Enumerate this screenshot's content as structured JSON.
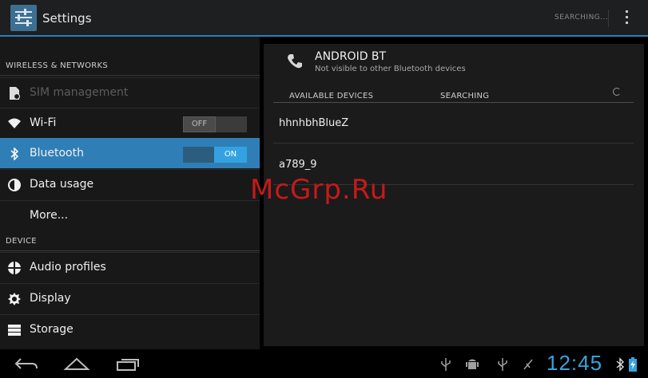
{
  "action_bar": {
    "title": "Settings",
    "status": "SEARCHING..."
  },
  "sidebar": {
    "sections": [
      {
        "header": "WIRELESS & NETWORKS"
      },
      {
        "header": "DEVICE"
      }
    ],
    "items": [
      {
        "label": "SIM management",
        "icon": "sim-icon",
        "disabled": true
      },
      {
        "label": "Wi-Fi",
        "icon": "wifi-icon",
        "toggle": "OFF"
      },
      {
        "label": "Bluetooth",
        "icon": "bluetooth-icon",
        "toggle": "ON",
        "selected": true
      },
      {
        "label": "Data usage",
        "icon": "data-usage-icon"
      },
      {
        "label": "More...",
        "icon": ""
      },
      {
        "label": "Audio profiles",
        "icon": "audio-profiles-icon"
      },
      {
        "label": "Display",
        "icon": "display-icon"
      },
      {
        "label": "Storage",
        "icon": "storage-icon"
      }
    ]
  },
  "detail": {
    "device_name": "ANDROID BT",
    "device_subtitle": "Not visible to other Bluetooth devices",
    "available_header": "AVAILABLE DEVICES",
    "searching_label": "SEARCHING",
    "devices": [
      "hhnhbhBlueZ",
      "a789_9"
    ]
  },
  "watermark": "McGrp.Ru",
  "system_bar": {
    "clock": "12:45",
    "status_icons": [
      "usb-icon",
      "android-debug-icon",
      "usb-icon",
      "signal-icon",
      "bluetooth-icon",
      "battery-charging-icon"
    ],
    "nav_buttons": [
      "back-icon",
      "home-icon",
      "recent-apps-icon"
    ]
  },
  "colors": {
    "accent": "#2f7fb6",
    "toggle_on": "#34a2e0",
    "clock": "#35a4de",
    "watermark": "#c7191a"
  }
}
